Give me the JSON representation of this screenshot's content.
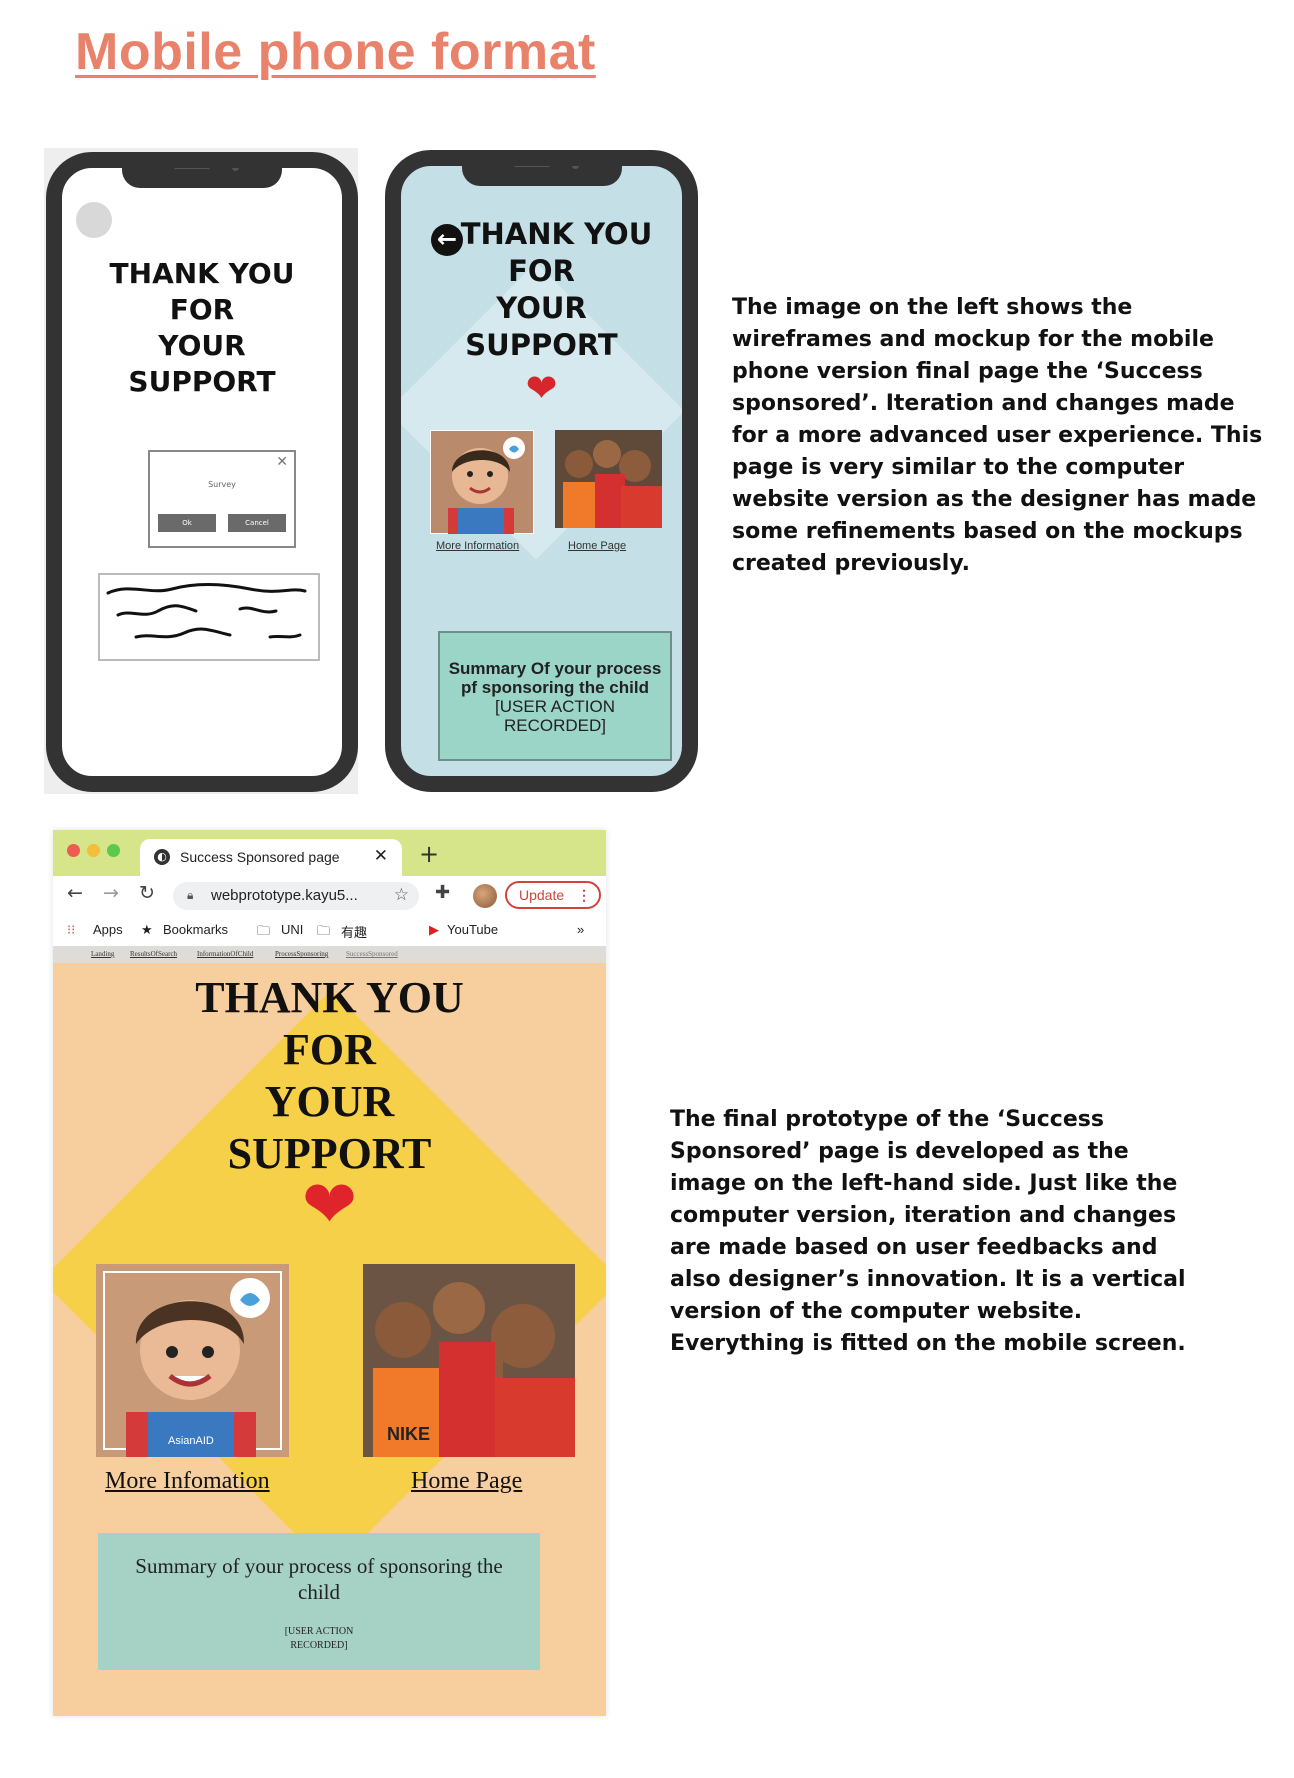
{
  "heading": "Mobile phone format",
  "wireframe": {
    "thank_lines": [
      "THANK YOU",
      "FOR",
      "YOUR",
      "SUPPORT"
    ],
    "dialog": {
      "label": "Survey",
      "ok": "Ok",
      "cancel": "Cancel"
    }
  },
  "mockup": {
    "thank_lines": [
      "THANK YOU",
      "FOR",
      "YOUR",
      "SUPPORT"
    ],
    "link_more": "More Information",
    "link_home": "Home Page",
    "summary_lines": [
      "Summary Of your process",
      "pf sponsoring the child",
      "[USER ACTION",
      "RECORDED]"
    ]
  },
  "paragraph_top": "The image on the left shows the wireframes and mockup for the mobile phone version final page the ‘Success sponsored’. Iteration and changes made for a more advanced user experience. This page is very similar to the computer website version as the designer has made some refinements based on the mockups created previously.",
  "paragraph_bottom": "The final prototype of the ‘Success Sponsored’ page is developed as the image on the left-hand side. Just like the computer version, iteration and changes are made based on user feedbacks and also designer’s innovation. It is a vertical version of the computer website. Everything is fitted on the mobile screen.",
  "browser": {
    "tab_title": "Success Sponsored page",
    "url": "webprototype.kayu5...",
    "update_label": "Update",
    "bookmarks": {
      "apps": "Apps",
      "bookmarks": "Bookmarks",
      "uni": "UNI",
      "fun": "有趣",
      "youtube": "YouTube",
      "more": "»"
    },
    "nav": [
      "Landing",
      "ResultsOfSearch",
      "InformationOfChild",
      "ProcessSponsoring",
      "SuccessSponsored"
    ],
    "thank_lines": [
      "THANK YOU",
      "FOR",
      "YOUR",
      "SUPPORT"
    ],
    "link_more": "More Infomation",
    "link_home": "Home Page",
    "summary_title": "Summary of your process of sponsoring the child",
    "summary_note_lines": [
      "[USER ACTION",
      "RECORDED]"
    ],
    "photo_logo_text": "AsianAID",
    "jersey_text": "NIKE"
  },
  "colors": {
    "heading": "#e9826a",
    "mockup_bg": "#c5dfe6",
    "summary_mint": "#9ad5c7",
    "page_peach": "#f7cf9e",
    "diamond_yellow": "#f7d04a",
    "heart_red": "#e0242b"
  }
}
